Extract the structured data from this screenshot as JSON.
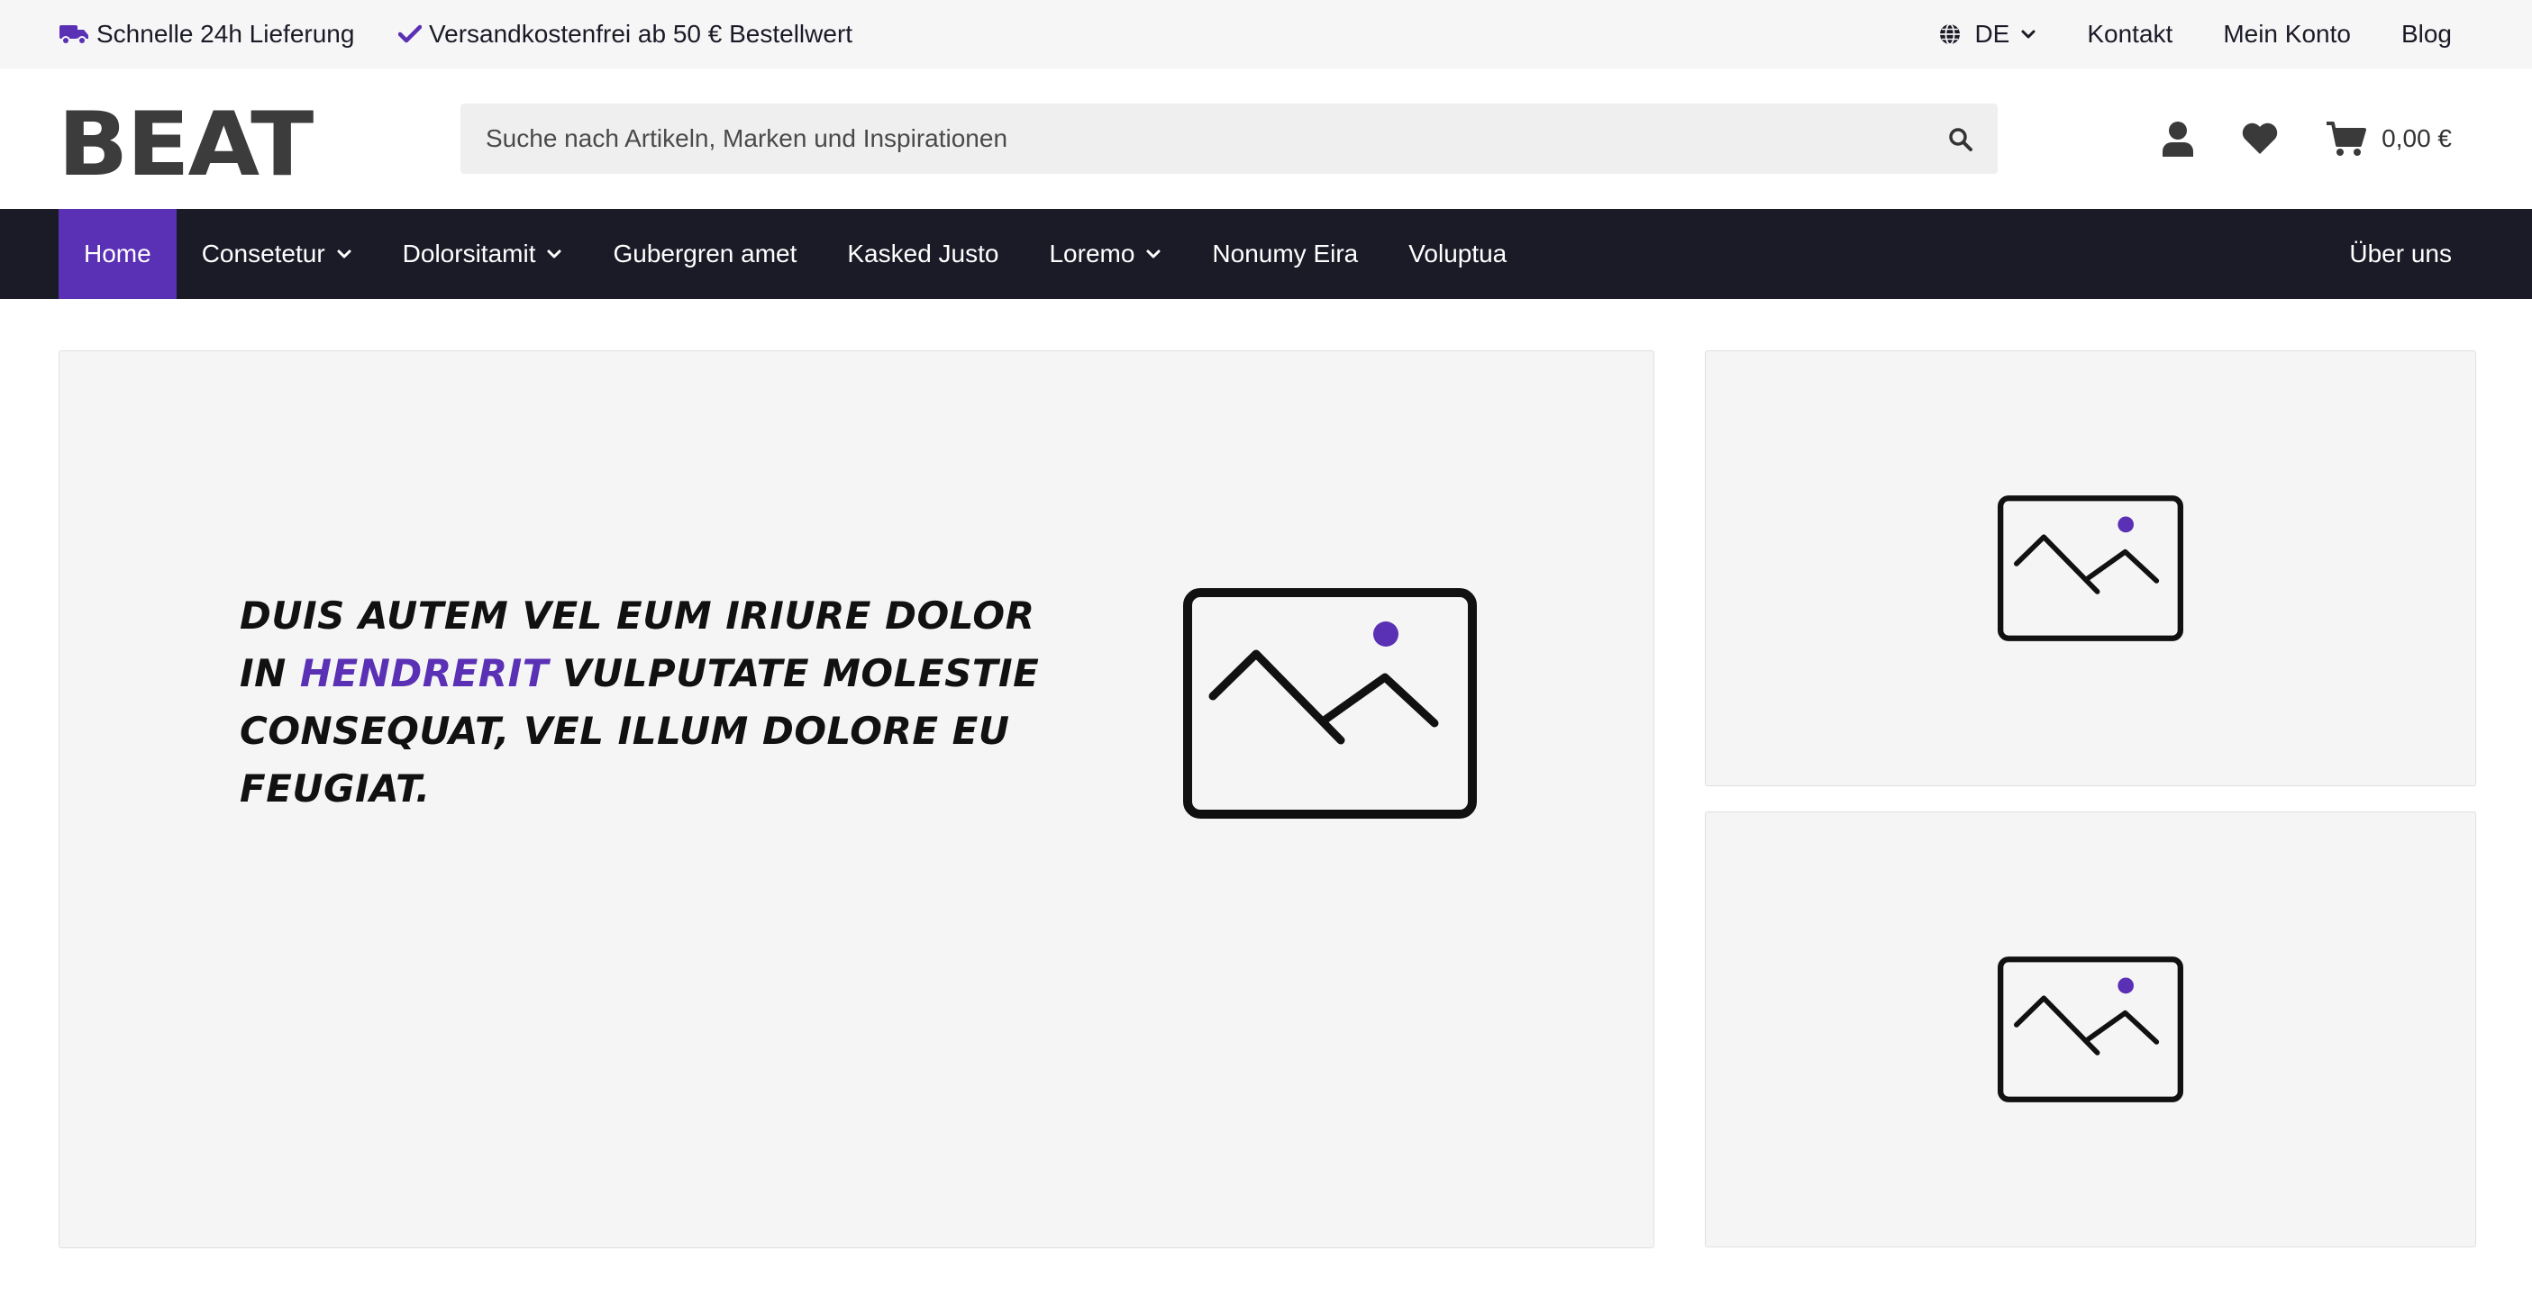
{
  "topbar": {
    "usp_delivery": "Schnelle 24h Lieferung",
    "usp_shipping": "Versandkostenfrei ab 50 € Bestellwert",
    "language": "DE",
    "links": [
      "Kontakt",
      "Mein Konto",
      "Blog"
    ]
  },
  "header": {
    "logo": "BEAT",
    "search_placeholder": "Suche nach Artikeln, Marken und Inspirationen",
    "cart_total": "0,00 €"
  },
  "nav": {
    "items": [
      {
        "label": "Home",
        "active": true,
        "has_dropdown": false
      },
      {
        "label": "Consetetur",
        "active": false,
        "has_dropdown": true
      },
      {
        "label": "Dolorsitamit",
        "active": false,
        "has_dropdown": true
      },
      {
        "label": "Gubergren amet",
        "active": false,
        "has_dropdown": false
      },
      {
        "label": "Kasked Justo",
        "active": false,
        "has_dropdown": false
      },
      {
        "label": "Loremo",
        "active": false,
        "has_dropdown": true
      },
      {
        "label": "Nonumy Eira",
        "active": false,
        "has_dropdown": false
      },
      {
        "label": "Voluptua",
        "active": false,
        "has_dropdown": false
      }
    ],
    "about": "Über uns"
  },
  "hero": {
    "text_before": "DUIS AUTEM VEL EUM IRIURE DOLOR IN ",
    "text_highlight": "HENDRERIT",
    "text_after": " VULPUTATE MOLESTIE CONSEQUAT, VEL ILLUM DOLORE EU FEUGIAT."
  },
  "colors": {
    "accent": "#5a30b5",
    "nav_bg": "#1b1b28",
    "topbar_bg": "#f6f6f6",
    "panel_bg": "#f5f5f5"
  },
  "icons": [
    "truck-icon",
    "check-icon",
    "globe-icon",
    "chevron-down-icon",
    "search-icon",
    "user-icon",
    "heart-icon",
    "cart-icon",
    "image-placeholder-icon"
  ]
}
